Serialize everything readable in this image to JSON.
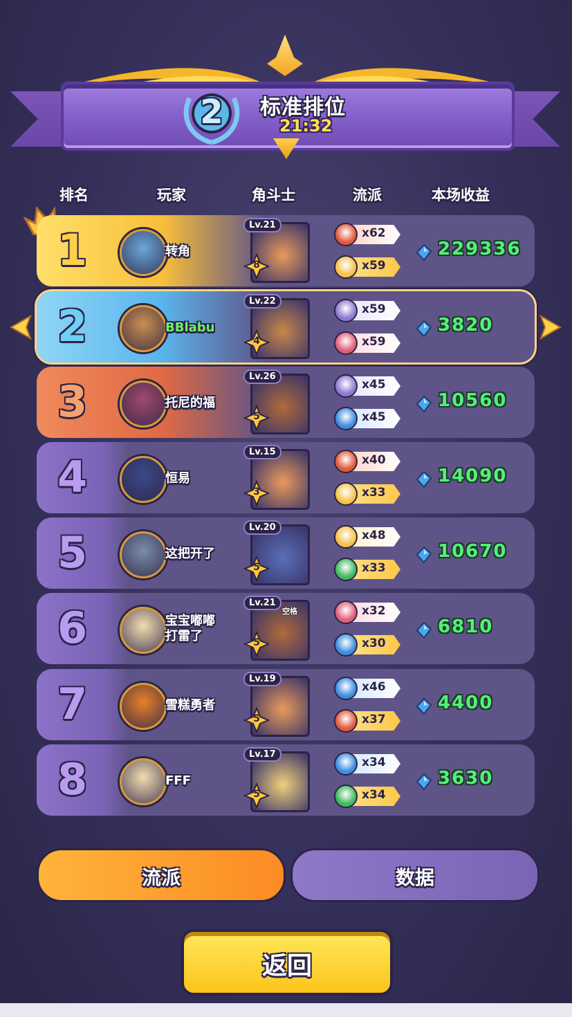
{
  "header": {
    "rank": "2",
    "title": "标准排位",
    "timer": "21:32"
  },
  "columns": {
    "rank": "排名",
    "player": "玩家",
    "hero": "角斗士",
    "school": "流派",
    "earnings": "本场收益"
  },
  "rows": [
    {
      "rank": "1",
      "player": "转角",
      "level": "Lv.21",
      "star": "8",
      "tags": [
        {
          "icon": "fire-icon",
          "count": "x62"
        },
        {
          "icon": "heart-icon",
          "count": "x59"
        }
      ],
      "earnings": "229336"
    },
    {
      "rank": "2",
      "player": "BBlabu",
      "level": "Lv.22",
      "star": "4",
      "tags": [
        {
          "icon": "sword-icon",
          "count": "x59"
        },
        {
          "icon": "feather-icon",
          "count": "x59"
        }
      ],
      "earnings": "3820"
    },
    {
      "rank": "3",
      "player": "托尼的福",
      "level": "Lv.26",
      "star": "5",
      "tags": [
        {
          "icon": "sword-icon",
          "count": "x45"
        },
        {
          "icon": "water-drop-icon",
          "count": "x45"
        }
      ],
      "earnings": "10560"
    },
    {
      "rank": "4",
      "player": "恒易",
      "level": "Lv.15",
      "star": "3",
      "tags": [
        {
          "icon": "fire-icon",
          "count": "x40"
        },
        {
          "icon": "heart-icon",
          "count": "x33"
        }
      ],
      "earnings": "14090"
    },
    {
      "rank": "5",
      "player": "这把开了",
      "level": "Lv.20",
      "star": "5",
      "tags": [
        {
          "icon": "heart-icon",
          "count": "x48"
        },
        {
          "icon": "potion-icon",
          "count": "x33"
        }
      ],
      "earnings": "10670"
    },
    {
      "rank": "6",
      "player": "宝宝嘟嘟打雷了",
      "player_line1": "宝宝嘟嘟",
      "player_line2": "打雷了",
      "level": "Lv.21",
      "hero_badge": "空格",
      "star": "5",
      "tags": [
        {
          "icon": "feather-icon",
          "count": "x32"
        },
        {
          "icon": "water-drop-icon",
          "count": "x30"
        }
      ],
      "earnings": "6810"
    },
    {
      "rank": "7",
      "player": "雪糕勇者",
      "level": "Lv.19",
      "star": "5",
      "tags": [
        {
          "icon": "water-drop-icon",
          "count": "x46"
        },
        {
          "icon": "fire-icon",
          "count": "x37"
        }
      ],
      "earnings": "4400"
    },
    {
      "rank": "8",
      "player": "FFF",
      "level": "Lv.17",
      "star": "5",
      "tags": [
        {
          "icon": "water-drop-icon",
          "count": "x34"
        },
        {
          "icon": "potion-icon",
          "count": "x34"
        }
      ],
      "earnings": "3630"
    }
  ],
  "tabs": {
    "school": "流派",
    "data": "数据"
  },
  "back_button": "返回",
  "colors": {
    "earnings": "#53f07a",
    "gold": "#fbc41c",
    "row_bg": "#5f5488",
    "rank1": "#ffe06a",
    "rank2": "#8fd6f6",
    "rank3": "#f08a5c"
  }
}
